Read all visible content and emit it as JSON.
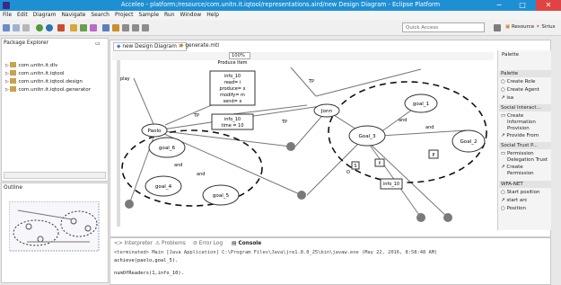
{
  "window": {
    "title": "Acceleo - platform:/resource/com.unitn.it.iqtool/representations.aird/new Design Diagram - Eclipse Platform",
    "min": "−",
    "max": "□",
    "close": "✕"
  },
  "menu": [
    "File",
    "Edit",
    "Diagram",
    "Navigate",
    "Search",
    "Project",
    "Sample",
    "Run",
    "Window",
    "Help"
  ],
  "toolbar": {
    "quick_access": "Quick Access",
    "perspectives": [
      "Resource",
      "Sirius",
      "Acceleo"
    ]
  },
  "package_explorer": {
    "tab": "Package Explorer",
    "items": [
      "com.unitn.it.dlv",
      "com.unitn.it.iqtool",
      "com.unitn.it.iqtool.design",
      "com.unitn.it.iqtool.generator"
    ]
  },
  "outline": {
    "tab": "Outline"
  },
  "editor": {
    "tabs": [
      "new Design Diagram",
      "generate.mtl"
    ],
    "zoom": "100%"
  },
  "diagram": {
    "actors": [
      {
        "name": "Paolo"
      },
      {
        "name": "Jonn"
      }
    ],
    "goals": [
      "goal_6",
      "goal_4",
      "goal_5",
      "Goal_3",
      "goal_1",
      "Goal_2"
    ],
    "info1": [
      "info_10",
      "read= i",
      "produce= x",
      "modify= m",
      "send= x"
    ],
    "info2": [
      "info_10",
      "time = 10"
    ],
    "info3": "info_10",
    "rel_labels": [
      "play",
      "TP",
      "TP",
      "TP",
      "and",
      "and",
      "and",
      "and",
      "P",
      "P",
      "S",
      "O",
      "TP"
    ],
    "prod_label": "Produce Item"
  },
  "palette": {
    "title": "Palette",
    "sections": [
      {
        "name": "Palette",
        "items": [
          "Create Role",
          "Create Agent",
          "isa"
        ]
      },
      {
        "name": "Social Interact...",
        "items": [
          "Create",
          "Information",
          "Provision",
          "Provide From"
        ]
      },
      {
        "name": "Social Trust P...",
        "items": [
          "Permission",
          "Delegation Trust",
          "Create",
          "Permission"
        ]
      },
      {
        "name": "WFA-NET",
        "items": [
          "Start position",
          "start arc",
          "Position"
        ]
      }
    ]
  },
  "console": {
    "tabs": [
      "Interpreter",
      "Problems",
      "Error Log",
      "Console"
    ],
    "terminated": "<terminated> Main [Java Application] C:\\Program Files\\Java\\jre1.8.0_25\\bin\\javaw.exe (May 22, 2016, 8:58:48 AM)",
    "lines": [
      "achieve(paolo,goal_5).",
      "numOfReaders(1,info_10)."
    ]
  }
}
